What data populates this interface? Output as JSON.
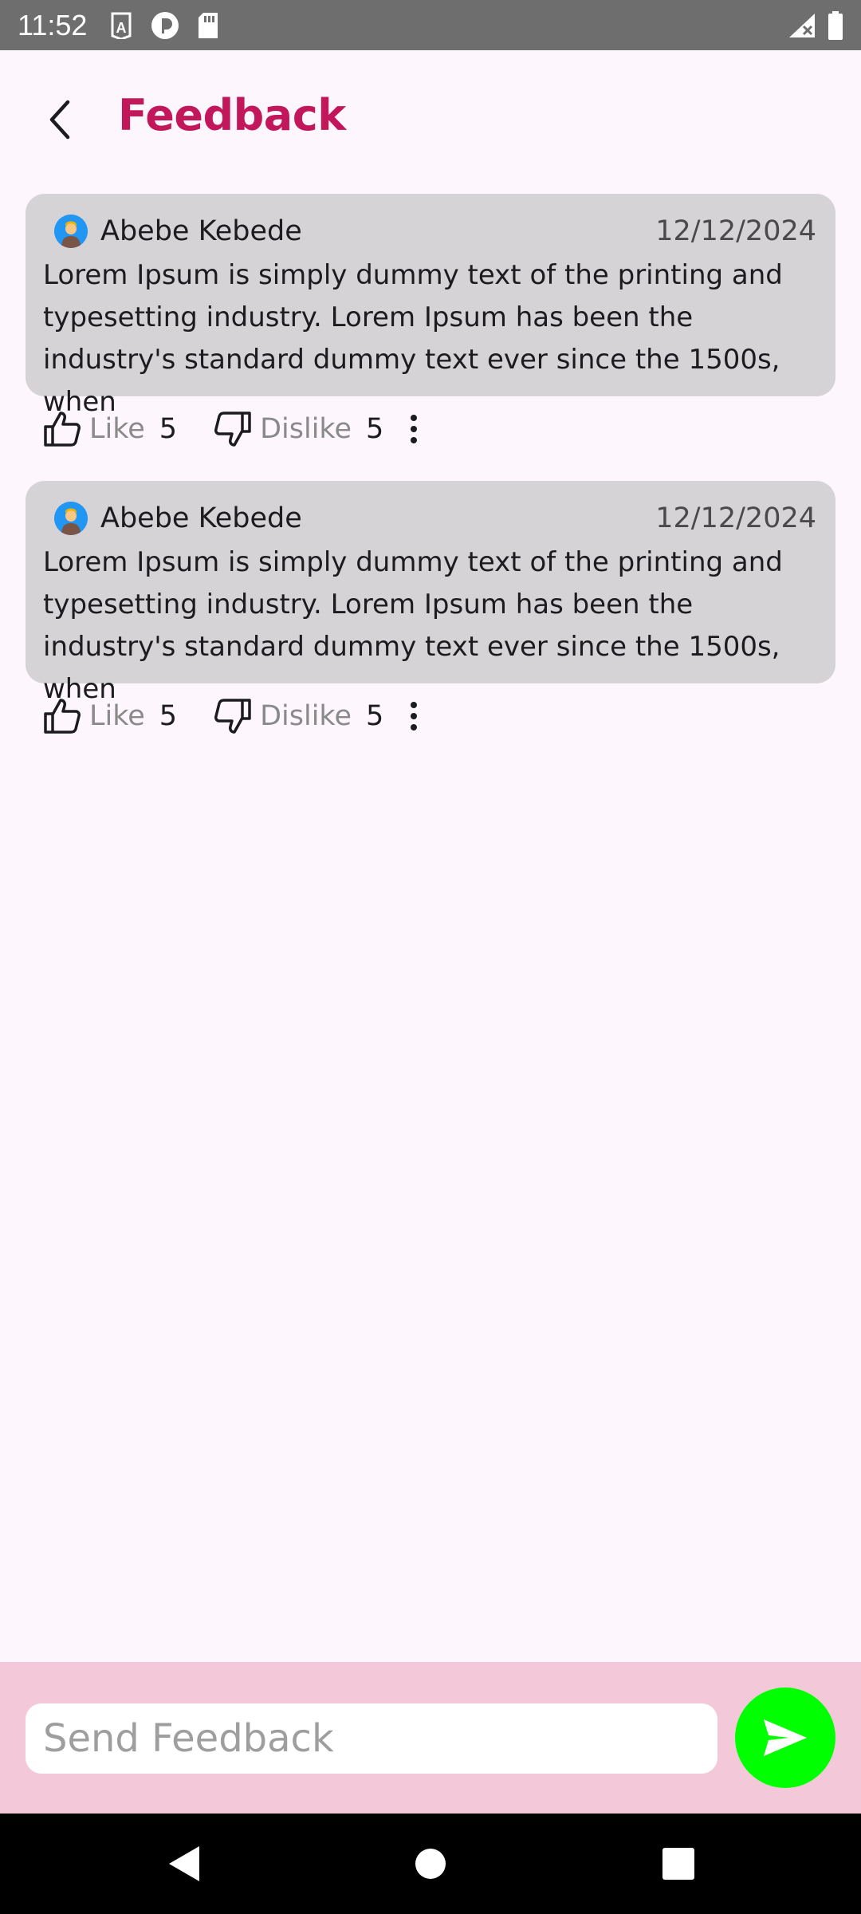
{
  "status_bar": {
    "time": "11:52"
  },
  "app_bar": {
    "title": "Feedback",
    "back_icon": "chevron-left-icon"
  },
  "feedbacks": [
    {
      "author": "Abebe Kebede",
      "date": "12/12/2024",
      "text": "Lorem Ipsum is simply dummy text of the printing and typesetting industry. Lorem Ipsum has been the industry's standard dummy text ever since the 1500s, when",
      "like_label": "Like",
      "like_count": "5",
      "dislike_label": "Dislike",
      "dislike_count": "5"
    },
    {
      "author": "Abebe Kebede",
      "date": "12/12/2024",
      "text": "Lorem Ipsum is simply dummy text of the printing and typesetting industry. Lorem Ipsum has been the industry's standard dummy text ever since the 1500s, when",
      "like_label": "Like",
      "like_count": "5",
      "dislike_label": "Dislike",
      "dislike_count": "5"
    }
  ],
  "compose": {
    "placeholder": "Send Feedback",
    "value": ""
  },
  "colors": {
    "title": "#c2185b",
    "card": "#d6d3d6",
    "compose_bar": "#f3c9da",
    "send_button": "#00ff00",
    "background": "#fdf7fd"
  }
}
